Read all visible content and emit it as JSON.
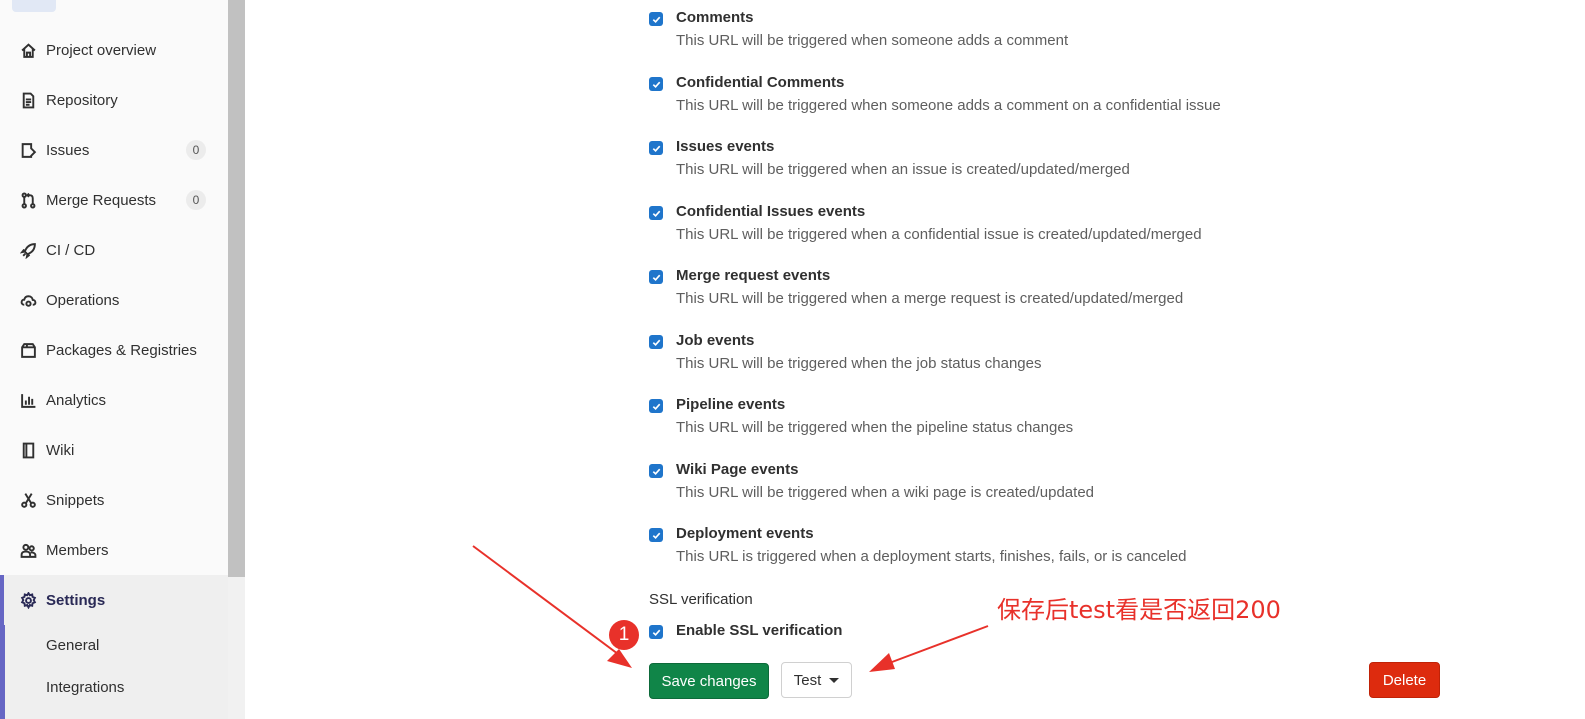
{
  "sidebar": {
    "items": [
      {
        "label": "Project overview",
        "icon": "home-icon"
      },
      {
        "label": "Repository",
        "icon": "document-icon"
      },
      {
        "label": "Issues",
        "icon": "issues-icon",
        "badge": "0"
      },
      {
        "label": "Merge Requests",
        "icon": "merge-request-icon",
        "badge": "0"
      },
      {
        "label": "CI / CD",
        "icon": "rocket-icon"
      },
      {
        "label": "Operations",
        "icon": "cloud-gear-icon"
      },
      {
        "label": "Packages & Registries",
        "icon": "package-icon"
      },
      {
        "label": "Analytics",
        "icon": "chart-icon"
      },
      {
        "label": "Wiki",
        "icon": "book-icon"
      },
      {
        "label": "Snippets",
        "icon": "scissors-icon"
      },
      {
        "label": "Members",
        "icon": "users-icon"
      },
      {
        "label": "Settings",
        "icon": "gear-icon",
        "active": true
      }
    ],
    "settings_sub": [
      {
        "label": "General"
      },
      {
        "label": "Integrations"
      }
    ]
  },
  "events": [
    {
      "title": "Comments",
      "desc": "This URL will be triggered when someone adds a comment",
      "checked": true
    },
    {
      "title": "Confidential Comments",
      "desc": "This URL will be triggered when someone adds a comment on a confidential issue",
      "checked": true
    },
    {
      "title": "Issues events",
      "desc": "This URL will be triggered when an issue is created/updated/merged",
      "checked": true
    },
    {
      "title": "Confidential Issues events",
      "desc": "This URL will be triggered when a confidential issue is created/updated/merged",
      "checked": true
    },
    {
      "title": "Merge request events",
      "desc": "This URL will be triggered when a merge request is created/updated/merged",
      "checked": true
    },
    {
      "title": "Job events",
      "desc": "This URL will be triggered when the job status changes",
      "checked": true
    },
    {
      "title": "Pipeline events",
      "desc": "This URL will be triggered when the pipeline status changes",
      "checked": true
    },
    {
      "title": "Wiki Page events",
      "desc": "This URL will be triggered when a wiki page is created/updated",
      "checked": true
    },
    {
      "title": "Deployment events",
      "desc": "This URL is triggered when a deployment starts, finishes, fails, or is canceled",
      "checked": true
    }
  ],
  "ssl": {
    "section_label": "SSL verification",
    "checkbox_label": "Enable SSL verification",
    "checked": true
  },
  "buttons": {
    "save": "Save changes",
    "test": "Test",
    "delete": "Delete"
  },
  "annotation": {
    "number": "1",
    "text": "保存后test看是否返回200",
    "color": "#e8312a"
  },
  "colors": {
    "checkbox": "#1f75cb",
    "save": "#108548",
    "delete": "#dd2b0e",
    "active_nav": "#6666c4"
  }
}
